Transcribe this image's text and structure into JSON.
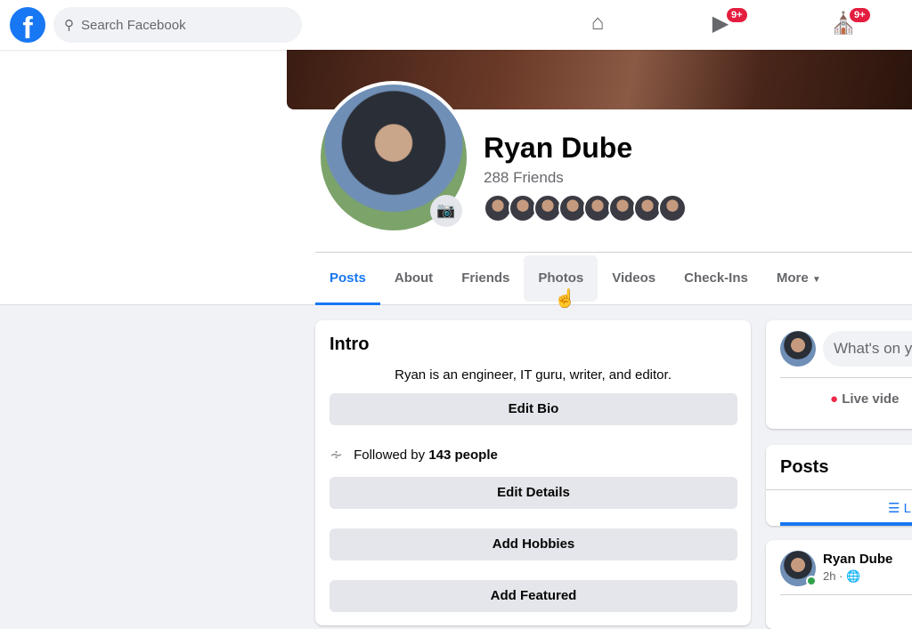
{
  "header": {
    "search_placeholder": "Search Facebook",
    "video_badge": "9+",
    "marketplace_badge": "9+",
    "logo": "f"
  },
  "profile": {
    "name": "Ryan Dube",
    "friends": "288 Friends"
  },
  "tabs": [
    {
      "label": "Posts"
    },
    {
      "label": "About"
    },
    {
      "label": "Friends"
    },
    {
      "label": "Photos"
    },
    {
      "label": "Videos"
    },
    {
      "label": "Check-Ins"
    },
    {
      "label": "More"
    }
  ],
  "intro": {
    "title": "Intro",
    "bio": "Ryan is an engineer, IT guru, writer, and editor.",
    "edit_bio": "Edit Bio",
    "followed_prefix": "Followed by",
    "followed_count": "143 people",
    "edit_details": "Edit Details",
    "add_hobbies": "Add Hobbies",
    "add_featured": "Add Featured"
  },
  "composer": {
    "placeholder": "What's on y",
    "live_video": "Live vide"
  },
  "posts": {
    "title": "Posts",
    "list_view": "L"
  },
  "post": {
    "author": "Ryan Dube",
    "time": "2h ·"
  },
  "colors": {
    "accent": "#1877f2",
    "badge": "#e41e3f",
    "background": "#f0f2f5"
  }
}
